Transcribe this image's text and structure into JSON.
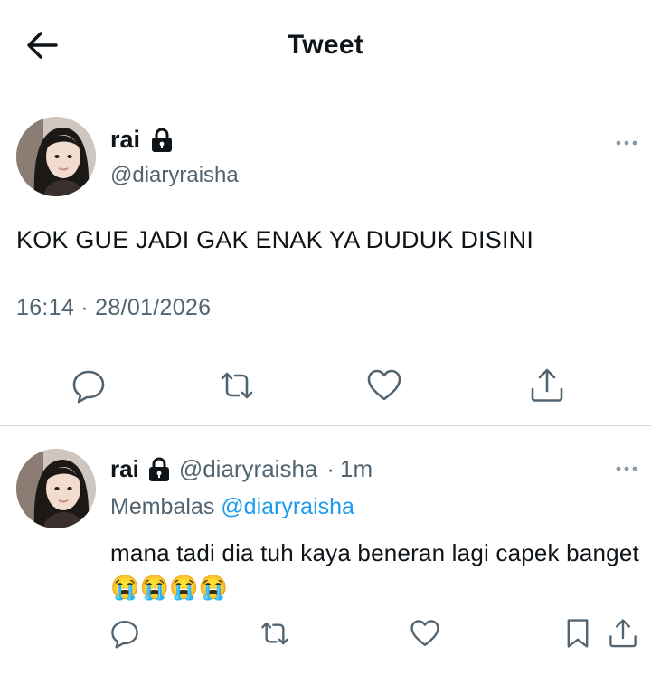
{
  "header": {
    "title": "Tweet",
    "back_icon": "arrow-left-icon"
  },
  "main_tweet": {
    "display_name": "rai",
    "handle": "@diaryraisha",
    "protected_icon": "lock-icon",
    "text": "KOK GUE JADI GAK ENAK YA DUDUK DISINI",
    "timestamp": "16:14 · 28/01/2026",
    "actions": [
      "reply-icon",
      "retweet-icon",
      "like-icon",
      "share-icon"
    ]
  },
  "reply": {
    "display_name": "rai",
    "handle": "@diaryraisha",
    "separator": "·",
    "time_ago": "1m",
    "replying_label": "Membalas",
    "replying_to": "@diaryraisha",
    "text": "mana tadi dia tuh kaya beneran lagi capek banget😭😭😭😭",
    "actions": [
      "reply-icon",
      "retweet-icon",
      "like-icon",
      "bookmark-icon",
      "share-icon"
    ]
  },
  "colors": {
    "text": "#0f1419",
    "secondary": "#536471",
    "link": "#1d9bf0",
    "divider": "#d4d9dd"
  }
}
